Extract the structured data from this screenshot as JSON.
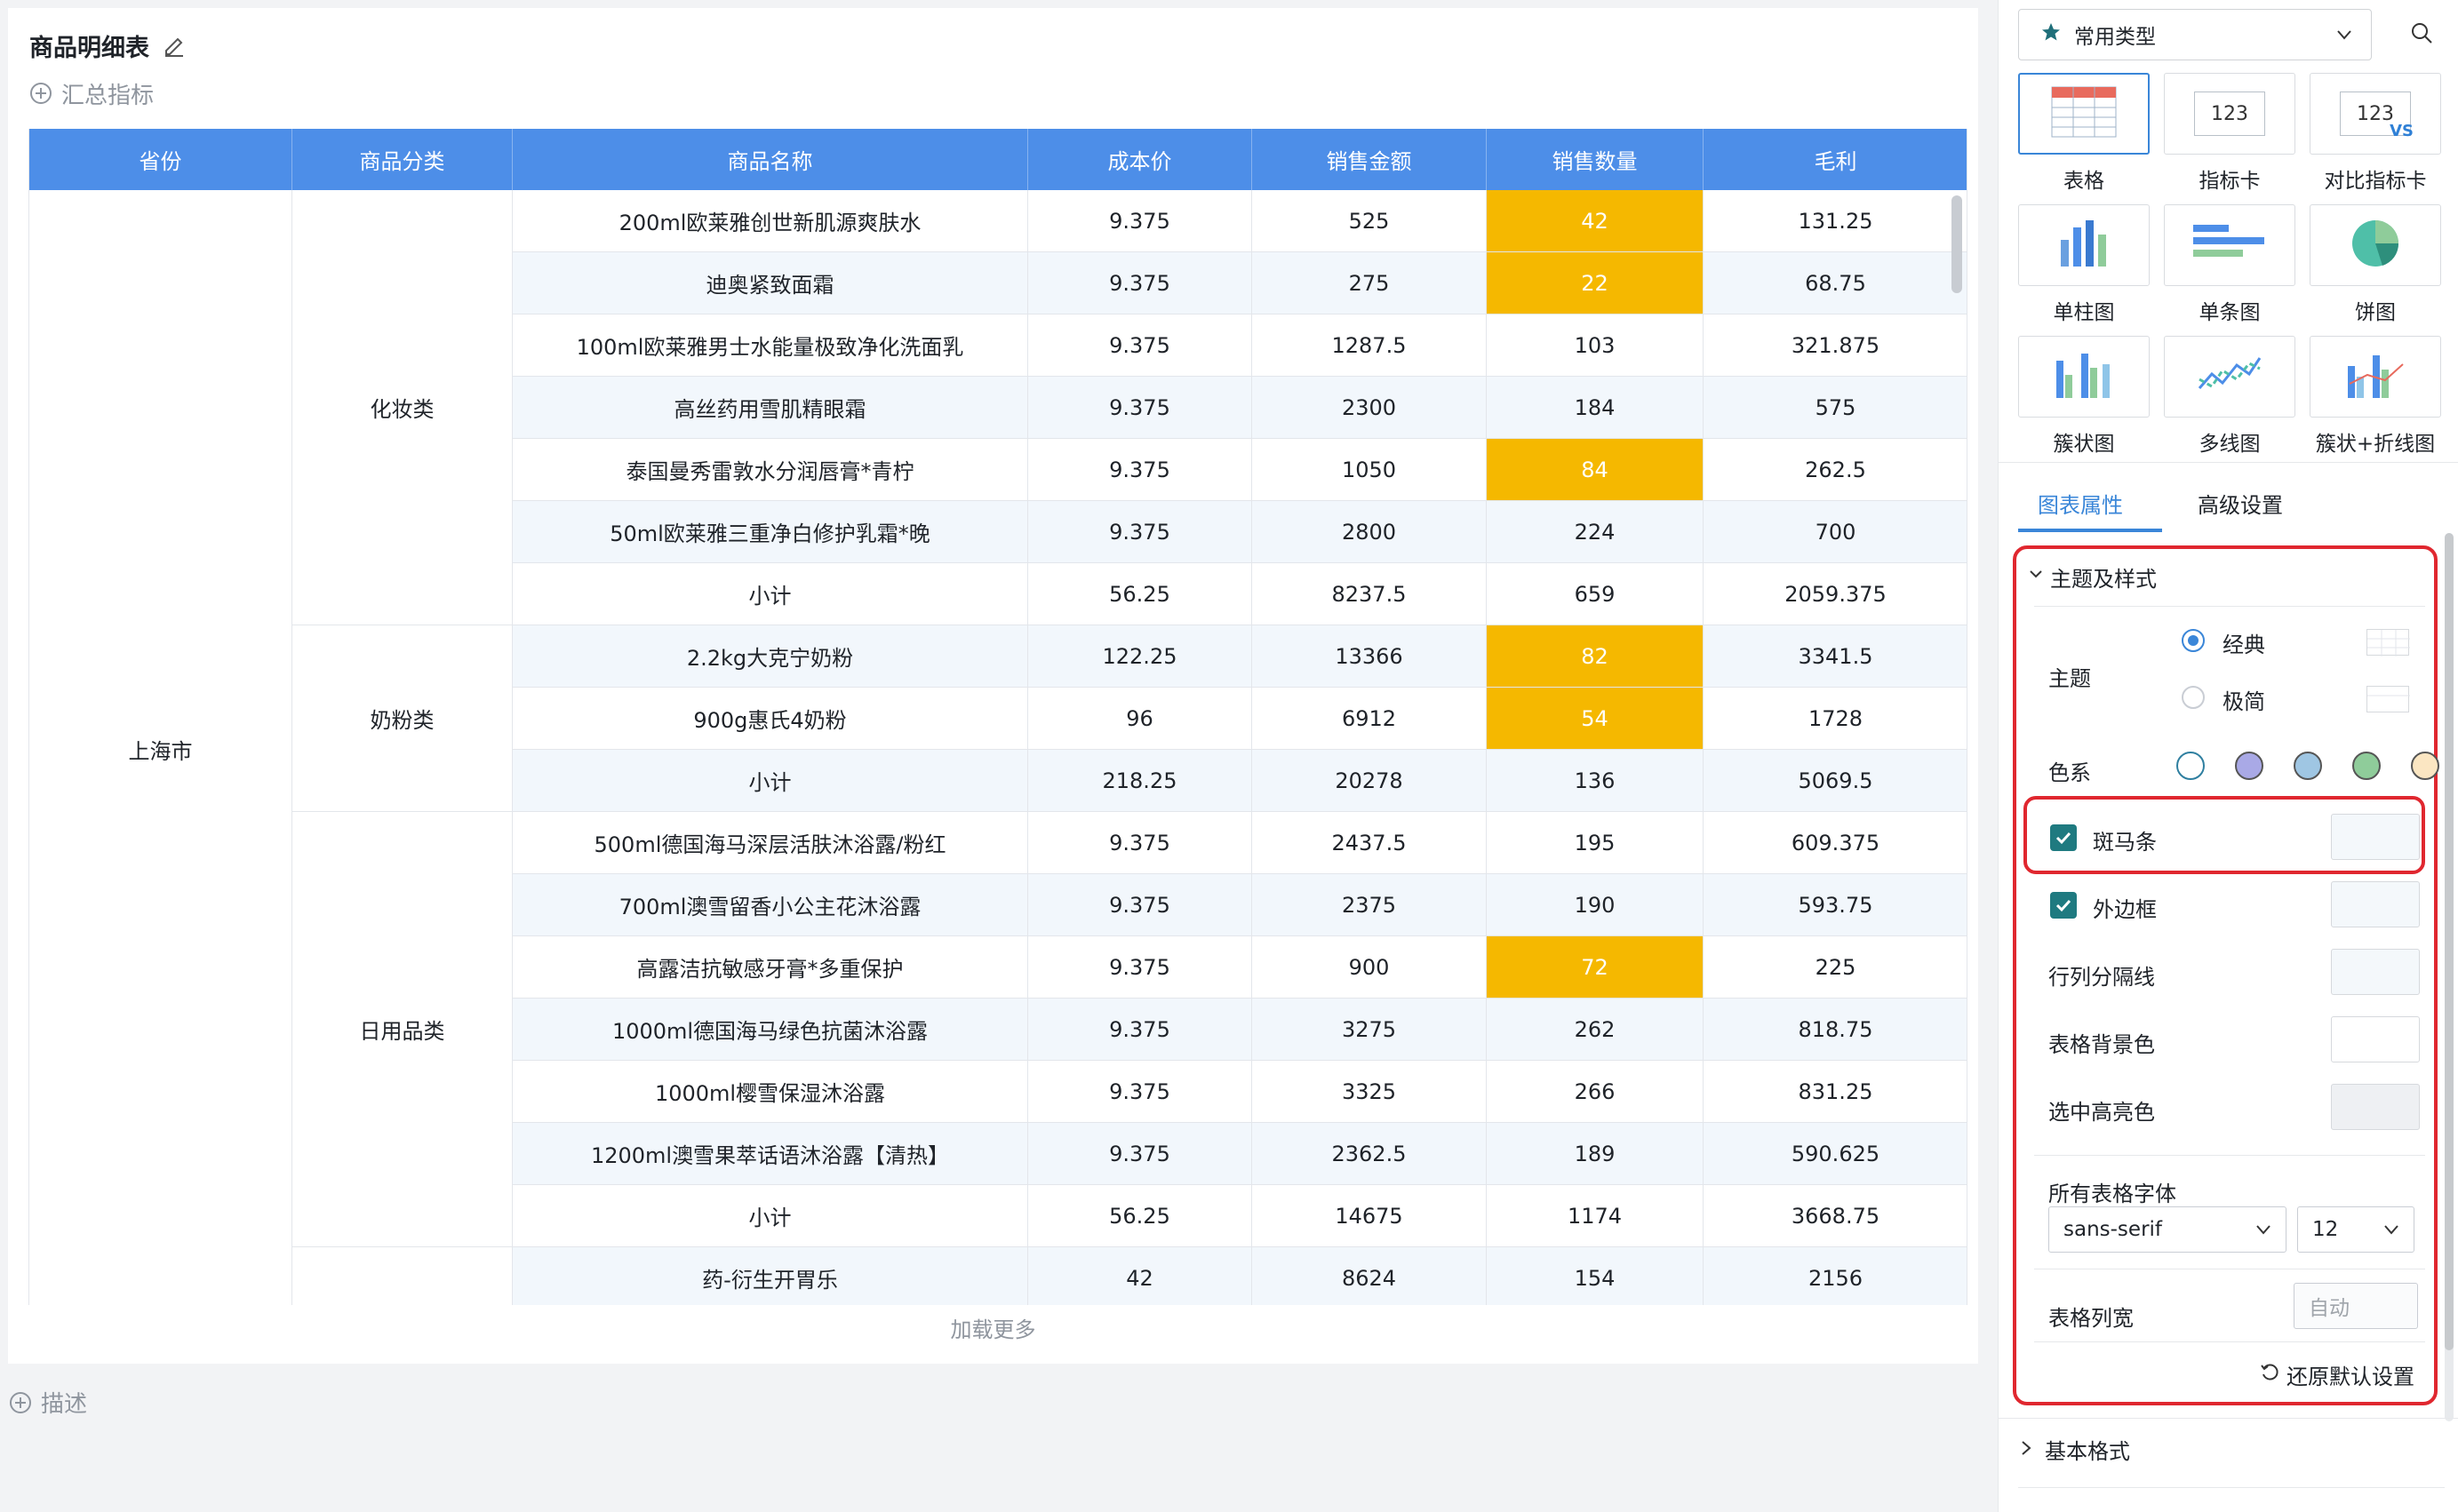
{
  "page": {
    "title": "商品明细表",
    "summary_label": "汇总指标",
    "load_more": "加载更多",
    "description_label": "描述"
  },
  "table": {
    "headers": [
      "省份",
      "商品分类",
      "商品名称",
      "成本价",
      "销售金额",
      "销售数量",
      "毛利"
    ],
    "province": "上海市",
    "groups": [
      {
        "category": "化妆类",
        "rows": [
          {
            "name": "200ml欧莱雅创世新肌源爽肤水",
            "cost": "9.375",
            "amount": "525",
            "qty": "42",
            "profit": "131.25",
            "highlight": true
          },
          {
            "name": "迪奥紧致面霜",
            "cost": "9.375",
            "amount": "275",
            "qty": "22",
            "profit": "68.75",
            "highlight": true
          },
          {
            "name": "100ml欧莱雅男士水能量极致净化洗面乳",
            "cost": "9.375",
            "amount": "1287.5",
            "qty": "103",
            "profit": "321.875",
            "highlight": false
          },
          {
            "name": "高丝药用雪肌精眼霜",
            "cost": "9.375",
            "amount": "2300",
            "qty": "184",
            "profit": "575",
            "highlight": false
          },
          {
            "name": "泰国曼秀雷敦水分润唇膏*青柠",
            "cost": "9.375",
            "amount": "1050",
            "qty": "84",
            "profit": "262.5",
            "highlight": true
          },
          {
            "name": "50ml欧莱雅三重净白修护乳霜*晚",
            "cost": "9.375",
            "amount": "2800",
            "qty": "224",
            "profit": "700",
            "highlight": false
          },
          {
            "name": "小计",
            "cost": "56.25",
            "amount": "8237.5",
            "qty": "659",
            "profit": "2059.375",
            "highlight": false
          }
        ]
      },
      {
        "category": "奶粉类",
        "rows": [
          {
            "name": "2.2kg大克宁奶粉",
            "cost": "122.25",
            "amount": "13366",
            "qty": "82",
            "profit": "3341.5",
            "highlight": true
          },
          {
            "name": "900g惠氏4奶粉",
            "cost": "96",
            "amount": "6912",
            "qty": "54",
            "profit": "1728",
            "highlight": true
          },
          {
            "name": "小计",
            "cost": "218.25",
            "amount": "20278",
            "qty": "136",
            "profit": "5069.5",
            "highlight": false
          }
        ]
      },
      {
        "category": "日用品类",
        "rows": [
          {
            "name": "500ml德国海马深层活肤沐浴露/粉红",
            "cost": "9.375",
            "amount": "2437.5",
            "qty": "195",
            "profit": "609.375",
            "highlight": false
          },
          {
            "name": "700ml澳雪留香小公主花沐浴露",
            "cost": "9.375",
            "amount": "2375",
            "qty": "190",
            "profit": "593.75",
            "highlight": false
          },
          {
            "name": "高露洁抗敏感牙膏*多重保护",
            "cost": "9.375",
            "amount": "900",
            "qty": "72",
            "profit": "225",
            "highlight": true
          },
          {
            "name": "1000ml德国海马绿色抗菌沐浴露",
            "cost": "9.375",
            "amount": "3275",
            "qty": "262",
            "profit": "818.75",
            "highlight": false
          },
          {
            "name": "1000ml樱雪保湿沐浴露",
            "cost": "9.375",
            "amount": "3325",
            "qty": "266",
            "profit": "831.25",
            "highlight": false
          },
          {
            "name": "1200ml澳雪果萃话语沐浴露【清热】",
            "cost": "9.375",
            "amount": "2362.5",
            "qty": "189",
            "profit": "590.625",
            "highlight": false
          },
          {
            "name": "小计",
            "cost": "56.25",
            "amount": "14675",
            "qty": "1174",
            "profit": "3668.75",
            "highlight": false
          }
        ]
      },
      {
        "category": "",
        "rows": [
          {
            "name": "药-衍生开胃乐",
            "cost": "42",
            "amount": "8624",
            "qty": "154",
            "profit": "2156",
            "highlight": false
          }
        ]
      }
    ]
  },
  "panel": {
    "type_select": "常用类型",
    "tiles": [
      {
        "label": "表格",
        "icon": "table-chart-icon",
        "selected": true
      },
      {
        "label": "指标卡",
        "icon": "kpi-card-icon",
        "text": "123"
      },
      {
        "label": "对比指标卡",
        "icon": "compare-kpi-icon",
        "text": "123",
        "vs": "VS"
      },
      {
        "label": "单柱图",
        "icon": "column-chart-icon"
      },
      {
        "label": "单条图",
        "icon": "bar-chart-icon"
      },
      {
        "label": "饼图",
        "icon": "pie-chart-icon"
      },
      {
        "label": "簇状图",
        "icon": "clustered-column-icon"
      },
      {
        "label": "多线图",
        "icon": "multi-line-icon"
      },
      {
        "label": "簇状+折线图",
        "icon": "column-line-combo-icon"
      }
    ],
    "tabs": [
      "图表属性",
      "高级设置"
    ],
    "section_title": "主题及样式",
    "theme_label": "主题",
    "theme_options": [
      "经典",
      "极简"
    ],
    "color_label": "色系",
    "colors": [
      "#ffffff",
      "#a9a9e6",
      "#9fc6e3",
      "#8fcc9a",
      "#fbe6c2"
    ],
    "zebra_label": "斑马条",
    "border_label": "外边框",
    "gridline_label": "行列分隔线",
    "bg_label": "表格背景色",
    "selected_label": "选中高亮色",
    "font_label": "所有表格字体",
    "font_family": "sans-serif",
    "font_size": "12",
    "col_width_label": "表格列宽",
    "col_width_placeholder": "自动",
    "reset_label": "还原默认设置",
    "basic_format_label": "基本格式"
  }
}
